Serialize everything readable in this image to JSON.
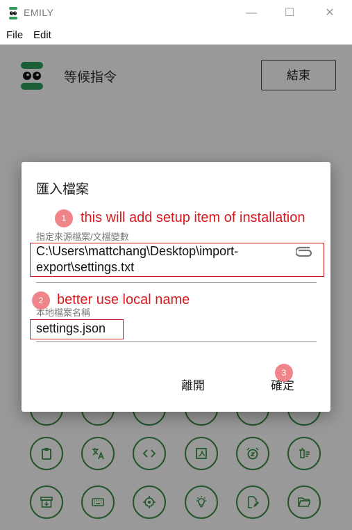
{
  "window": {
    "title": "EMILY",
    "minimize": "—",
    "maximize": "☐",
    "close": "✕"
  },
  "menu": {
    "items": [
      "File",
      "Edit"
    ]
  },
  "header": {
    "status": "等候指令",
    "end_button": "結束"
  },
  "dialog": {
    "title": "匯入檔案",
    "source_label": "指定來源檔案/文檔變數",
    "source_value_line1": "C:\\Users\\mattchang\\Desktop\\import-",
    "source_value_line2": "export\\settings.txt",
    "local_label": "本地檔案名稱",
    "local_value": "settings.json",
    "cancel_button": "離開",
    "confirm_button": "確定"
  },
  "annotations": {
    "badge1": "1",
    "note1": "this will add setup item of installation",
    "badge2": "2",
    "note2": "better use local name",
    "badge3": "3"
  },
  "colors": {
    "accent_green": "#3a8f46",
    "logo_green": "#2d9f5b",
    "annotation_red": "#d61a1f",
    "badge_pink": "#f08589"
  },
  "tools": {
    "icons": [
      "clipboard-icon",
      "translate-icon",
      "code-icon",
      "pdf-icon",
      "alarm-icon",
      "delete-list-icon",
      "archive-icon",
      "keyboard-icon",
      "target-icon",
      "lightbulb-icon",
      "edit-file-icon",
      "folder-open-icon"
    ]
  }
}
